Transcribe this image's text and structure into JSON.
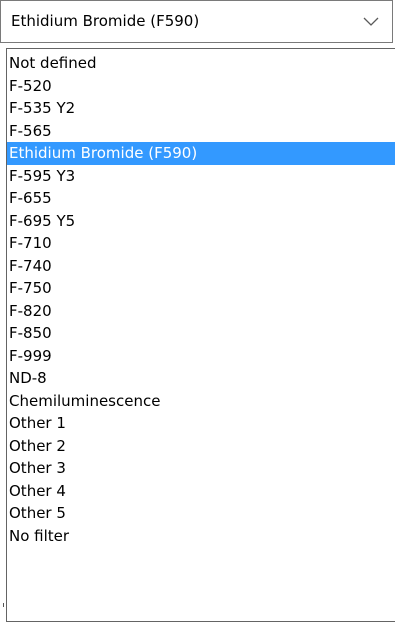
{
  "combo": {
    "value": "Ethidium Bromide (F590)",
    "arrow_icon": "chevron-down-icon"
  },
  "dropdown": {
    "selected_index": 4,
    "options": [
      "Not defined",
      "F-520",
      "F-535 Y2",
      "F-565",
      "Ethidium Bromide (F590)",
      "F-595 Y3",
      "F-655",
      "F-695 Y5",
      "F-710",
      "F-740",
      "F-750",
      "F-820",
      "F-850",
      "F-999",
      "ND-8",
      "Chemiluminescence",
      "Other 1",
      "Other 2",
      "Other 3",
      "Other 4",
      "Other 5",
      "No filter"
    ]
  },
  "colors": {
    "selection_background": "#3399ff",
    "selection_text": "#ffffff",
    "border": "#7a7a7a"
  }
}
